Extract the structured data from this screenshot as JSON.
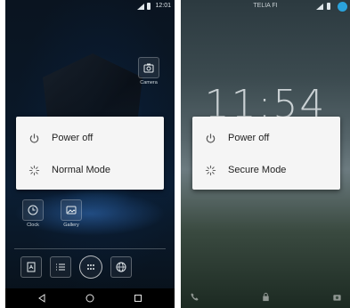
{
  "left": {
    "status_time": "12:01",
    "apps": {
      "camera": "Camera",
      "clock": "Clock",
      "gallery": "Gallery"
    },
    "dialog": {
      "power_off": "Power off",
      "mode": "Normal Mode"
    }
  },
  "right": {
    "carrier": "TELIA FI",
    "clock": "11:54",
    "dialog": {
      "power_off": "Power off",
      "mode": "Secure Mode"
    }
  },
  "colors": {
    "accent": "#2aa3dc",
    "dialog_bg": "#f5f5f5",
    "dialog_text": "#222222"
  }
}
